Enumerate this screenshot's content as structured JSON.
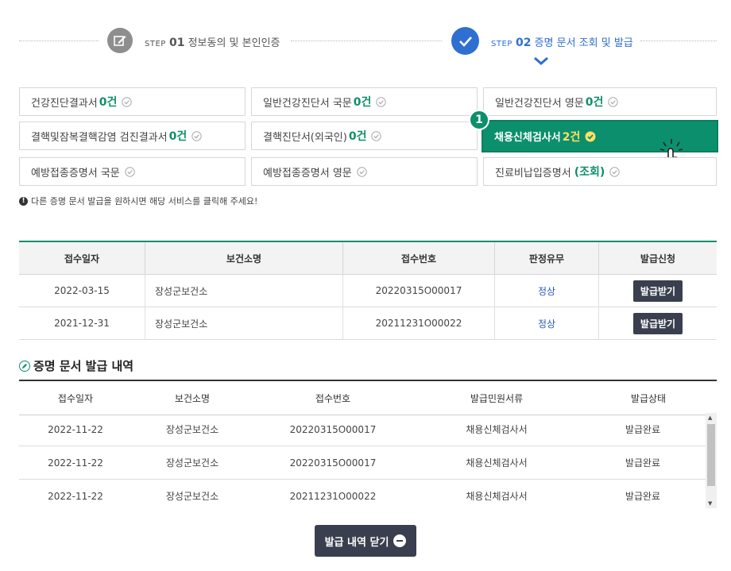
{
  "steps": {
    "step1": {
      "prefix": "STEP",
      "num": "01",
      "label": "정보동의 및 본인인증"
    },
    "step2": {
      "prefix": "STEP",
      "num": "02",
      "label": "증명 문서 조회 및 발급"
    }
  },
  "services": [
    {
      "label": "건강진단결과서",
      "count": "0건"
    },
    {
      "label": "일반건강진단서 국문",
      "count": "0건"
    },
    {
      "label": "일반건강진단서 영문",
      "count": "0건"
    },
    {
      "label": "결핵및잠복결핵감염 검진결과서",
      "count": "0건"
    },
    {
      "label": "결핵진단서(외국인)",
      "count": "0건"
    },
    {
      "label": "채용신체검사서",
      "count": "2건"
    },
    {
      "label": "예방접종증명서 국문",
      "count": ""
    },
    {
      "label": "예방접종증명서 영문",
      "count": ""
    },
    {
      "label": "진료비납입증명서",
      "count": "(조회)"
    }
  ],
  "badge": "1",
  "notice": "다른 증명 문서 발급을 원하시면 해당 서비스를 클릭해 주세요!",
  "table1": {
    "headers": [
      "접수일자",
      "보건소명",
      "접수번호",
      "판정유무",
      "발급신청"
    ],
    "rows": [
      {
        "date": "2022-03-15",
        "center": "장성군보건소",
        "no": "20220315O00017",
        "status": "정상",
        "action": "발급받기"
      },
      {
        "date": "2021-12-31",
        "center": "장성군보건소",
        "no": "20211231O00022",
        "status": "정상",
        "action": "발급받기"
      }
    ]
  },
  "history_title": "증명 문서 발급 내역",
  "table2": {
    "headers": [
      "접수일자",
      "보건소명",
      "접수번호",
      "발급민원서류",
      "발급상태"
    ],
    "rows": [
      {
        "date": "2022-11-22",
        "center": "장성군보건소",
        "no": "20220315O00017",
        "doc": "채용신체검사서",
        "state": "발급완료"
      },
      {
        "date": "2022-11-22",
        "center": "장성군보건소",
        "no": "20220315O00017",
        "doc": "채용신체검사서",
        "state": "발급완료"
      },
      {
        "date": "2022-11-22",
        "center": "장성군보건소",
        "no": "20211231O00022",
        "doc": "채용신체검사서",
        "state": "발급완료"
      }
    ]
  },
  "close_button": "발급 내역 닫기",
  "colors": {
    "green": "#0c8f6c",
    "blue": "#2f6fd1",
    "dark": "#3a3f4f"
  }
}
